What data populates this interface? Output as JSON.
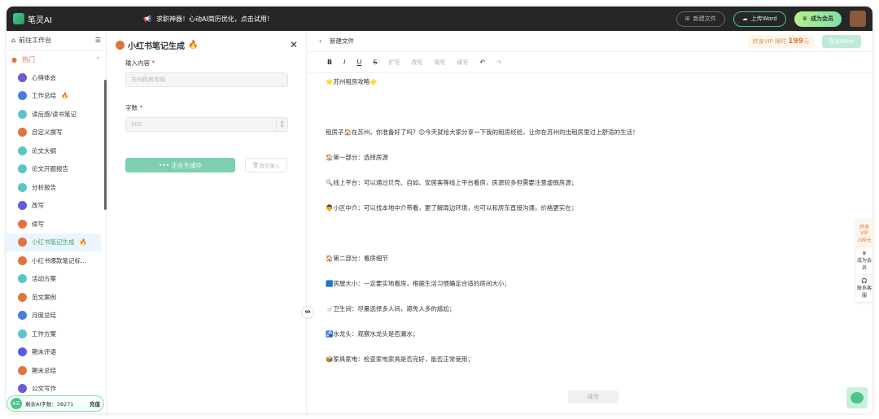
{
  "app": {
    "name": "笔灵AI",
    "notice": "求职神器！心动AI简历优化，点击试用！",
    "new_file": "新建文件",
    "upload": "上传Word",
    "member": "成为会员"
  },
  "sidebar": {
    "home": "前往工作台",
    "section": "热门",
    "items": [
      {
        "label": "心得体会",
        "color": "#6b5bd6",
        "hot": false
      },
      {
        "label": "工作总结",
        "color": "#4a7be0",
        "hot": true
      },
      {
        "label": "读后感/读书笔记",
        "color": "#5bc5c5",
        "hot": false
      },
      {
        "label": "自定义撰写",
        "color": "#e2733f",
        "hot": false
      },
      {
        "label": "论文大纲",
        "color": "#5bc5c5",
        "hot": false
      },
      {
        "label": "论文开题报告",
        "color": "#5bc5c5",
        "hot": false
      },
      {
        "label": "分析报告",
        "color": "#5bc5c5",
        "hot": false
      },
      {
        "label": "改写",
        "color": "#5a5be0",
        "hot": false
      },
      {
        "label": "续写",
        "color": "#e2733f",
        "hot": false
      },
      {
        "label": "小红书笔记生成",
        "color": "#e2733f",
        "hot": true,
        "active": true
      },
      {
        "label": "小红书爆款笔记标...",
        "color": "#e2733f",
        "hot": false
      },
      {
        "label": "活动方案",
        "color": "#5bc5c5",
        "hot": false
      },
      {
        "label": "范文案例",
        "color": "#e2733f",
        "hot": false
      },
      {
        "label": "月度总结",
        "color": "#4a7be0",
        "hot": false
      },
      {
        "label": "工作方案",
        "color": "#5bc5c5",
        "hot": false
      },
      {
        "label": "期末评语",
        "color": "#5a5be0",
        "hot": false
      },
      {
        "label": "期末总结",
        "color": "#e2733f",
        "hot": false
      },
      {
        "label": "公文写作",
        "color": "#6b5bd6",
        "hot": false
      }
    ],
    "quota_label": "剩余AI字数：38271",
    "recharge": "充值",
    "avatar_text": "A☰"
  },
  "form": {
    "title": "小红书笔记生成",
    "input_label": "输入内容",
    "input_value": "苏州租房攻略",
    "count_label": "字数",
    "count_value": "500",
    "generating": "正在生成中",
    "clear": "清空录入"
  },
  "editor": {
    "back": "新建文件",
    "vip_prefix": "终身VIP 限时",
    "vip_price": "199",
    "vip_unit": "元",
    "export": "导出Word",
    "tools": {
      "bold": "B",
      "italic": "I",
      "underline": "U",
      "strike": "S",
      "expand": "扩写",
      "rewrite": "改写",
      "shorten": "简写",
      "continue": "续写",
      "undo": "↶",
      "redo": "↷"
    },
    "lines": [
      "🌟苏州租房攻略🌟",
      "",
      "租房子🏠在苏州，你准备好了吗？😊今天就给大家分享一下我的租房经验，让你在苏州的出租房里过上舒适的生活！",
      "🏠第一部分：选择房源",
      "🔍线上平台：可以通过贝壳、自如、安居客等线上平台看房，房源较多但需要注意虚假房源；",
      "👨小区中介：可以找本地中介带看，更了解周边环境，也可以和房东直接沟通，价格更实在；",
      "",
      "🏠第二部分：看房细节",
      "🟦房屋大小：一定要实地看房，根据生活习惯确定合适的房间大小；",
      "🚽卫生间：尽量选择多人间，避免人多的尴尬；",
      "🚰水龙头：观察水龙头是否漏水；",
      "📦家具家电：检查家电家具是否完好，能否正常使用；"
    ],
    "float_continue": "续写"
  },
  "right_panel": {
    "vip": "终身VIP",
    "price": "199元",
    "member": "成为会员",
    "service": "联系客服"
  }
}
